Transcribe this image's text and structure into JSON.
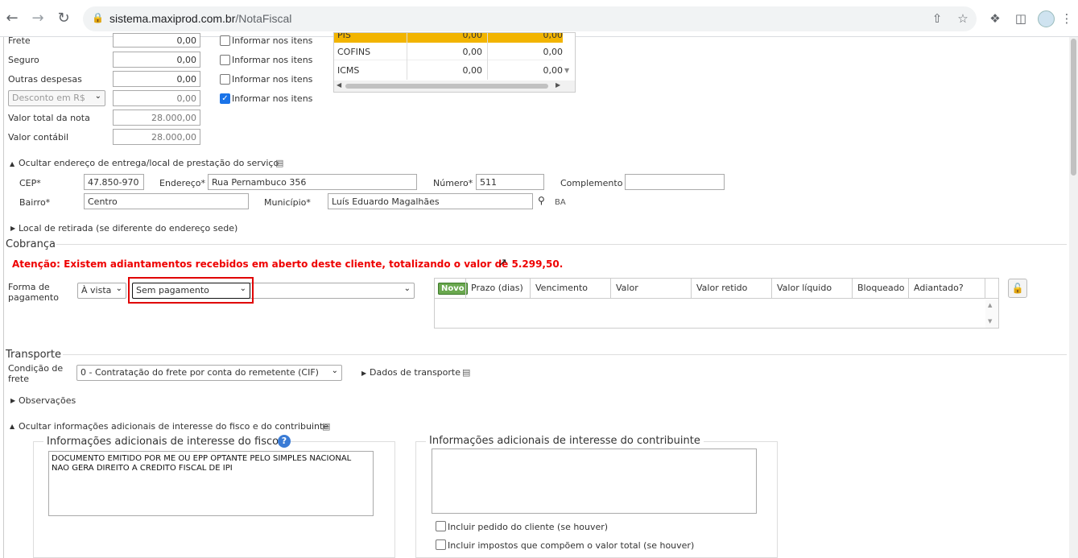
{
  "browser": {
    "url_host": "sistema.maxiprod.com.br",
    "url_path": "/NotaFiscal"
  },
  "totals": {
    "frete_label": "Frete",
    "frete_value": "0,00",
    "seguro_label": "Seguro",
    "seguro_value": "0,00",
    "outras_label": "Outras despesas",
    "outras_value": "0,00",
    "desconto_select": "Desconto em R$",
    "desconto_value": "0,00",
    "total_nota_label": "Valor total da nota",
    "total_nota_value": "28.000,00",
    "contabil_label": "Valor contábil",
    "contabil_value": "28.000,00",
    "informar_label": "Informar nos itens",
    "informar_checked": [
      false,
      false,
      false,
      true
    ]
  },
  "tax_table": {
    "rows": [
      {
        "name": "PIS",
        "v1": "0,00",
        "v2": "0,00"
      },
      {
        "name": "COFINS",
        "v1": "0,00",
        "v2": "0,00"
      },
      {
        "name": "ICMS",
        "v1": "0,00",
        "v2": "0,00"
      }
    ]
  },
  "address": {
    "toggle_label": "Ocultar endereço de entrega/local de prestação do serviço",
    "cep_label": "CEP*",
    "cep_value": "47.850-970",
    "endereco_label": "Endereço*",
    "endereco_value": "Rua Pernambuco 356",
    "numero_label": "Número*",
    "numero_value": "511",
    "complemento_label": "Complemento",
    "complemento_value": "",
    "bairro_label": "Bairro*",
    "bairro_value": "Centro",
    "municipio_label": "Município*",
    "municipio_value": "Luís Eduardo Magalhães",
    "uf": "BA",
    "retirada_label": "Local de retirada (se diferente do endereço sede)"
  },
  "cobranca": {
    "title": "Cobrança",
    "warning": "Atenção: Existem adiantamentos recebidos em aberto deste cliente, totalizando o valor de 5.299,50.",
    "forma_label_1": "Forma de",
    "forma_label_2": "pagamento",
    "forma_select": "À vista",
    "pagamento_select": "Sem pagamento",
    "grid": {
      "novo_label": "Novo",
      "columns": [
        "Prazo (dias)",
        "Vencimento",
        "Valor",
        "Valor retido",
        "Valor líquido",
        "Bloqueado",
        "Adiantado?"
      ]
    }
  },
  "transporte": {
    "title": "Transporte",
    "condicao_label_1": "Condição de",
    "condicao_label_2": "frete",
    "condicao_select": "0 - Contratação do frete por conta do remetente (CIF)",
    "dados_label": "Dados de transporte"
  },
  "observacoes": {
    "label": "Observações"
  },
  "adicionais": {
    "toggle_label": "Ocultar informações adicionais de interesse do fisco e do contribuinte",
    "fisco_title": "Informações adicionais de interesse do fisco",
    "fisco_text": "DOCUMENTO EMITIDO POR ME OU EPP OPTANTE PELO SIMPLES NACIONAL NAO GERA DIREITO A CREDITO FISCAL DE IPI",
    "contribuinte_title": "Informações adicionais de interesse do contribuinte",
    "contribuinte_text": "",
    "incluir_pedido": "Incluir pedido do cliente (se houver)",
    "incluir_impostos": "Incluir impostos que compõem o valor total (se houver)"
  },
  "colors": {
    "highlight_border": "#e00000",
    "tax_highlight": "#f2b400",
    "novo_green": "#6aa84f"
  }
}
